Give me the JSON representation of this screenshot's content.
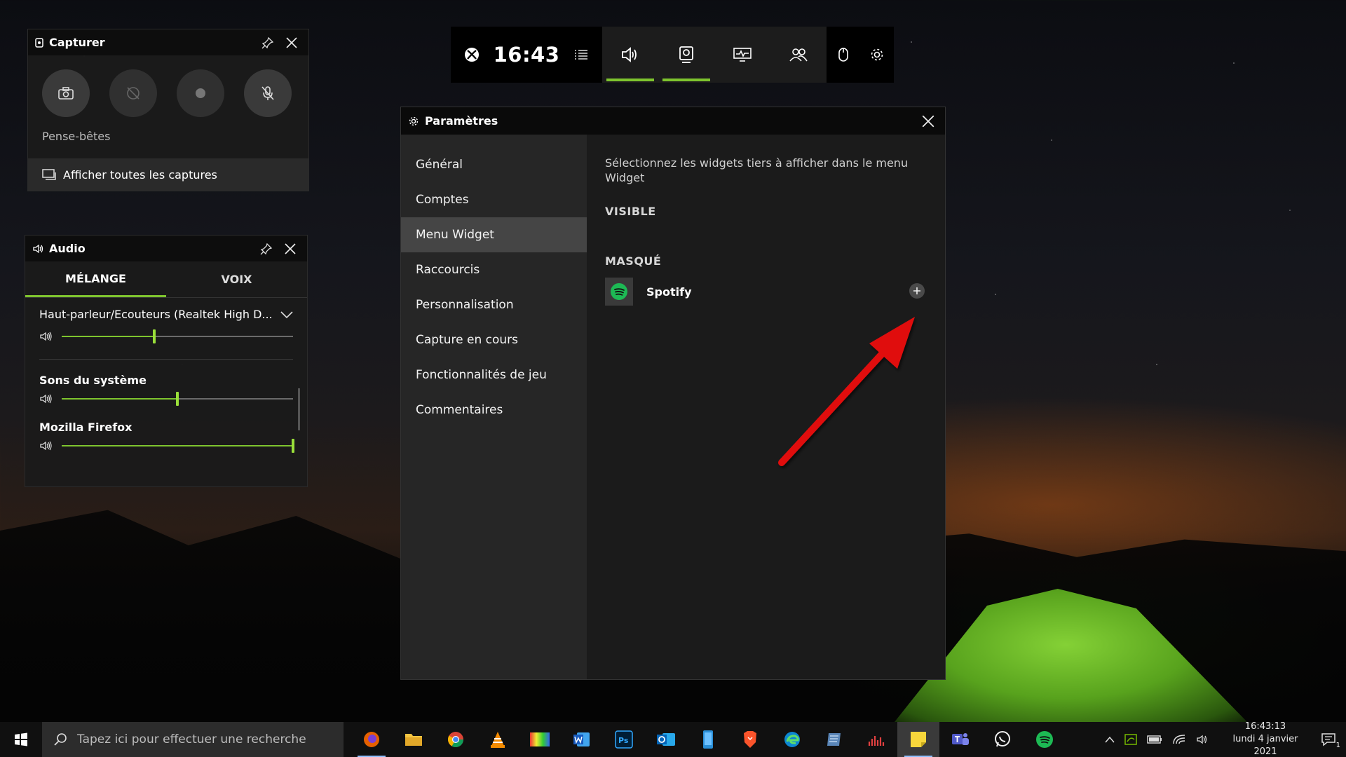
{
  "capture_panel": {
    "title": "Capturer",
    "pense_betes": "Pense-bêtes",
    "show_all": "Afficher toutes les captures"
  },
  "audio_panel": {
    "title": "Audio",
    "tabs": [
      "MÉLANGE",
      "VOIX"
    ],
    "device": "Haut-parleur/Ecouteurs (Realtek High D...",
    "device_volume": 0.4,
    "apps": [
      {
        "name": "Sons du système",
        "volume": 0.5
      },
      {
        "name": "Mozilla Firefox",
        "volume": 1.0
      }
    ]
  },
  "top_bar": {
    "time": "16:43"
  },
  "settings": {
    "title": "Paramètres",
    "nav": [
      "Général",
      "Comptes",
      "Menu Widget",
      "Raccourcis",
      "Personnalisation",
      "Capture en cours",
      "Fonctionnalités de jeu",
      "Commentaires"
    ],
    "selected_nav": "Menu Widget",
    "description": "Sélectionnez les widgets tiers à afficher dans le menu Widget",
    "visible_label": "VISIBLE",
    "hidden_label": "MASQUÉ",
    "hidden_widgets": [
      "Spotify"
    ]
  },
  "taskbar": {
    "search_placeholder": "Tapez ici pour effectuer une recherche",
    "time": "16:43:13",
    "date": "lundi 4 janvier 2021",
    "notification_count": "1"
  },
  "colors": {
    "accent_green": "#7ec42e",
    "arrow_red": "#e01010",
    "spotify_green": "#1db954"
  }
}
